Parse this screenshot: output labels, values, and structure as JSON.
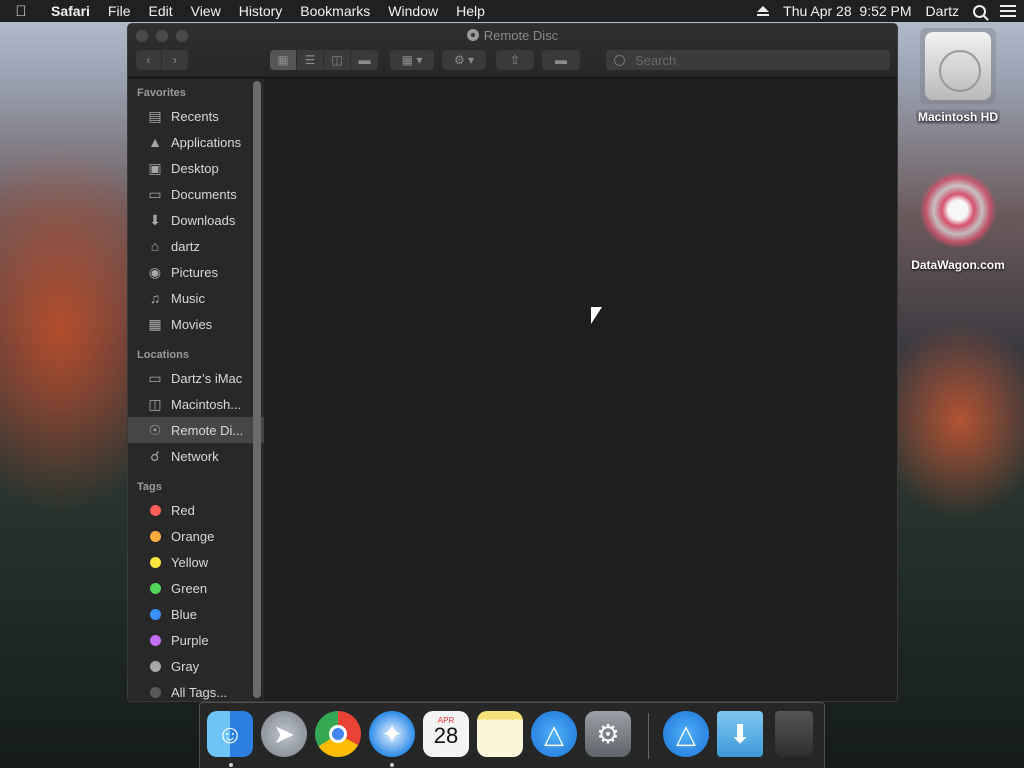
{
  "menubar": {
    "app": "Safari",
    "items": [
      "File",
      "Edit",
      "View",
      "History",
      "Bookmarks",
      "Window",
      "Help"
    ],
    "clock": "Thu Apr 28  9:52 PM",
    "user": "Dartz"
  },
  "window": {
    "title": "Remote Disc",
    "search_placeholder": "Search"
  },
  "sidebar": {
    "favorites_header": "Favorites",
    "favorites": [
      {
        "label": "Recents",
        "icon": "recents-icon"
      },
      {
        "label": "Applications",
        "icon": "applications-icon"
      },
      {
        "label": "Desktop",
        "icon": "desktop-icon"
      },
      {
        "label": "Documents",
        "icon": "documents-icon"
      },
      {
        "label": "Downloads",
        "icon": "downloads-icon"
      },
      {
        "label": "dartz",
        "icon": "home-icon"
      },
      {
        "label": "Pictures",
        "icon": "camera-icon"
      },
      {
        "label": "Music",
        "icon": "music-icon"
      },
      {
        "label": "Movies",
        "icon": "film-icon"
      }
    ],
    "locations_header": "Locations",
    "locations": [
      {
        "label": "Dartz’s iMac",
        "icon": "imac-icon"
      },
      {
        "label": "Macintosh...",
        "icon": "hard-drive-icon"
      },
      {
        "label": "Remote Di...",
        "icon": "disc-icon",
        "selected": true
      },
      {
        "label": "Network",
        "icon": "globe-icon"
      }
    ],
    "tags_header": "Tags",
    "tags": [
      {
        "label": "Red",
        "color": "#fc5f5a"
      },
      {
        "label": "Orange",
        "color": "#fdab3f"
      },
      {
        "label": "Yellow",
        "color": "#fde53f"
      },
      {
        "label": "Green",
        "color": "#52d456"
      },
      {
        "label": "Blue",
        "color": "#3a8ff9"
      },
      {
        "label": "Purple",
        "color": "#c26ef2"
      },
      {
        "label": "Gray",
        "color": "#a6a6a6"
      },
      {
        "label": "All Tags...",
        "color": "#5a5a5a"
      }
    ]
  },
  "desktop": {
    "hd_label": "Macintosh HD",
    "datawagon_label": "DataWagon.com"
  },
  "dock": {
    "calendar_month": "APR",
    "calendar_day": "28"
  }
}
